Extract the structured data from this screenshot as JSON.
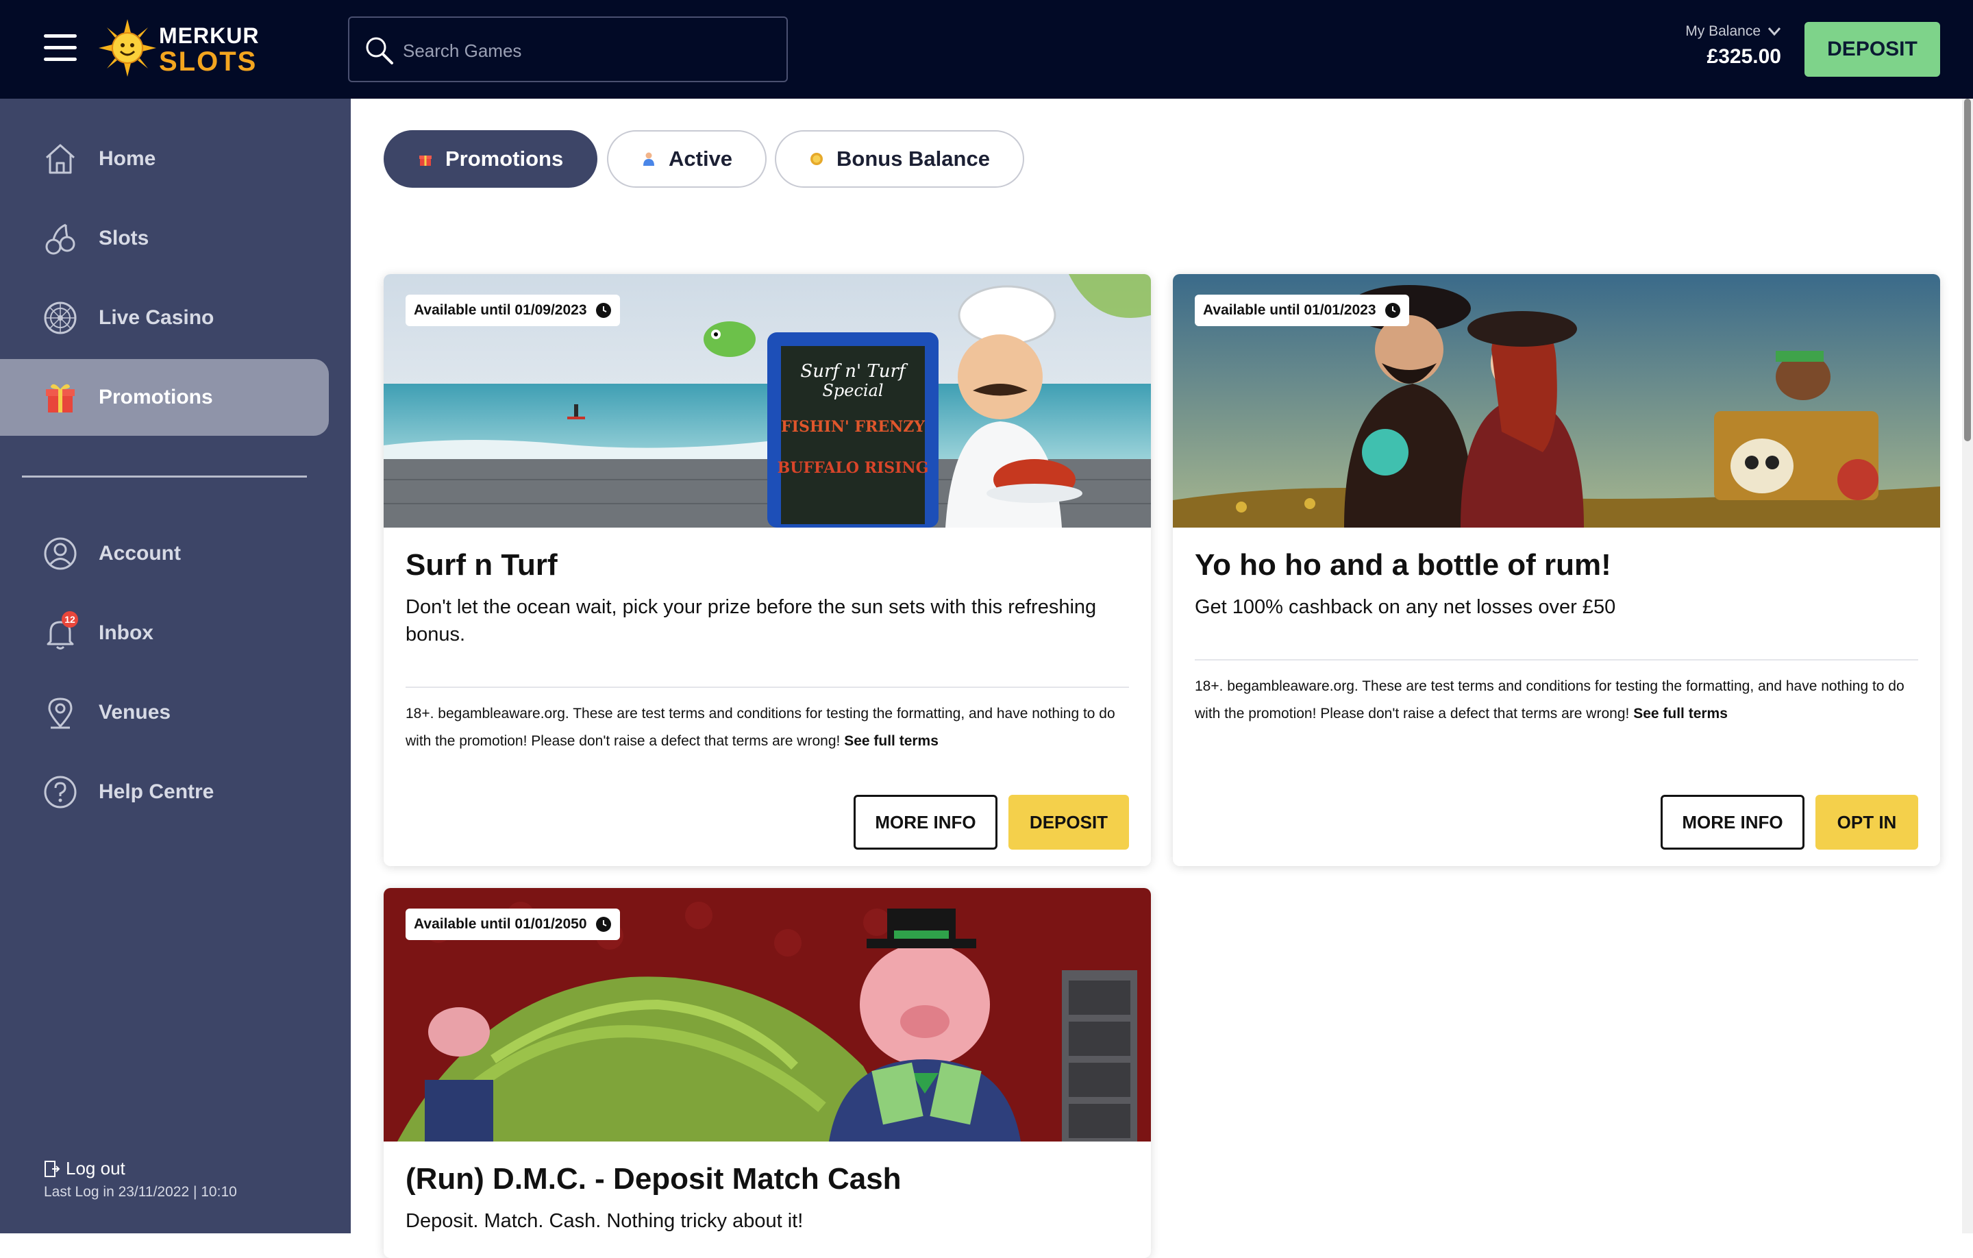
{
  "brand": {
    "line1": "MERKUR",
    "line2": "SLOTS"
  },
  "search": {
    "placeholder": "Search Games"
  },
  "balance": {
    "label": "My Balance",
    "value": "£325.00"
  },
  "header": {
    "deposit_label": "DEPOSIT"
  },
  "sidebar": {
    "items": [
      {
        "label": "Home",
        "icon": "home-icon"
      },
      {
        "label": "Slots",
        "icon": "cherries-icon"
      },
      {
        "label": "Live Casino",
        "icon": "roulette-wheel-icon"
      },
      {
        "label": "Promotions",
        "icon": "gift-icon",
        "active": true
      },
      {
        "label": "Account",
        "icon": "user-circle-icon"
      },
      {
        "label": "Inbox",
        "icon": "bell-icon",
        "badge": "12"
      },
      {
        "label": "Venues",
        "icon": "location-pin-icon"
      },
      {
        "label": "Help Centre",
        "icon": "question-circle-icon"
      }
    ],
    "logout_label": "Log out",
    "last_log": "Last Log in 23/11/2022 | 10:10"
  },
  "tabs": [
    {
      "label": "Promotions",
      "active": true,
      "icon": "gift-icon"
    },
    {
      "label": "Active",
      "active": false,
      "icon": "person-icon"
    },
    {
      "label": "Bonus Balance",
      "active": false,
      "icon": "coin-icon"
    }
  ],
  "promotions": [
    {
      "available": "Available until 01/09/2023",
      "title": "Surf n Turf",
      "description": "Don't let the ocean wait,  pick your prize before the sun sets with this refreshing bonus.",
      "terms": "18+. begambleaware.org. These are test terms and conditions for testing the formatting, and have nothing to do with the promotion! Please don't raise a defect that terms are wrong!",
      "terms_link": "See full terms",
      "primary_label": "MORE INFO",
      "secondary_label": "DEPOSIT",
      "image_text": {
        "line1": "Surf n' Turf",
        "line2": "Special",
        "line3": "FISHIN' FRENZY",
        "line4": "BUFFALO RISING"
      }
    },
    {
      "available": "Available until 01/01/2023",
      "title": "Yo ho ho and a bottle of rum!",
      "description": "Get 100% cashback on any net losses over £50",
      "terms": "18+. begambleaware.org. These are test terms and conditions for testing the formatting, and have nothing to do with the promotion! Please don't raise a defect that terms are wrong!",
      "terms_link": "See full terms",
      "primary_label": "MORE INFO",
      "secondary_label": "OPT IN"
    },
    {
      "available": "Available until 01/01/2050",
      "title": "(Run) D.M.C. - Deposit Match Cash",
      "description": "Deposit. Match. Cash. Nothing tricky about it!"
    }
  ],
  "colors": {
    "topbar": "#020a26",
    "sidebar": "#3d4567",
    "sidebar_active": "#8f94a9",
    "deposit_green": "#7ed38a",
    "button_yellow": "#f4d04b",
    "brand_orange": "#f3a51f"
  }
}
